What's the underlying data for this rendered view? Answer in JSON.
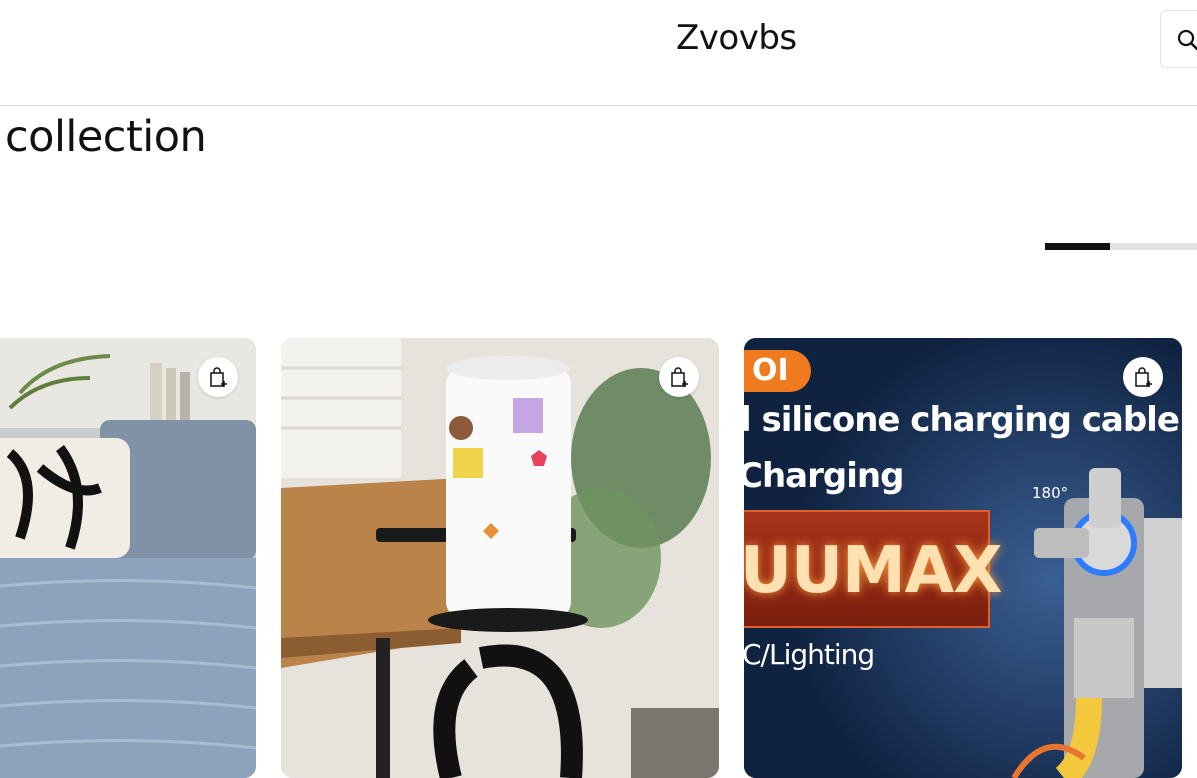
{
  "header": {
    "brand": "Zvovbs",
    "search_icon": "search-icon"
  },
  "section": {
    "title": "collection"
  },
  "carousel": {
    "progress_fraction": 0.43
  },
  "products": [
    {
      "image": "throw-blanket-on-sofa",
      "cart_icon": "add-to-cart-icon"
    },
    {
      "image": "desk-clamp-cup-holder",
      "cart_icon": "add-to-cart-icon"
    },
    {
      "image": "silicone-charging-cable",
      "cart_icon": "add-to-cart-icon",
      "promo": {
        "badge": "OI",
        "line1": "l silicone charging cable",
        "line2": "Charging",
        "brand": "UUMAX",
        "line3": "C/Lighting",
        "angle": "180°"
      }
    }
  ],
  "colors": {
    "accent": "#111111",
    "track": "#e2e2e2",
    "promo_orange": "#f07a1e",
    "promo_navy": "#13284a"
  }
}
